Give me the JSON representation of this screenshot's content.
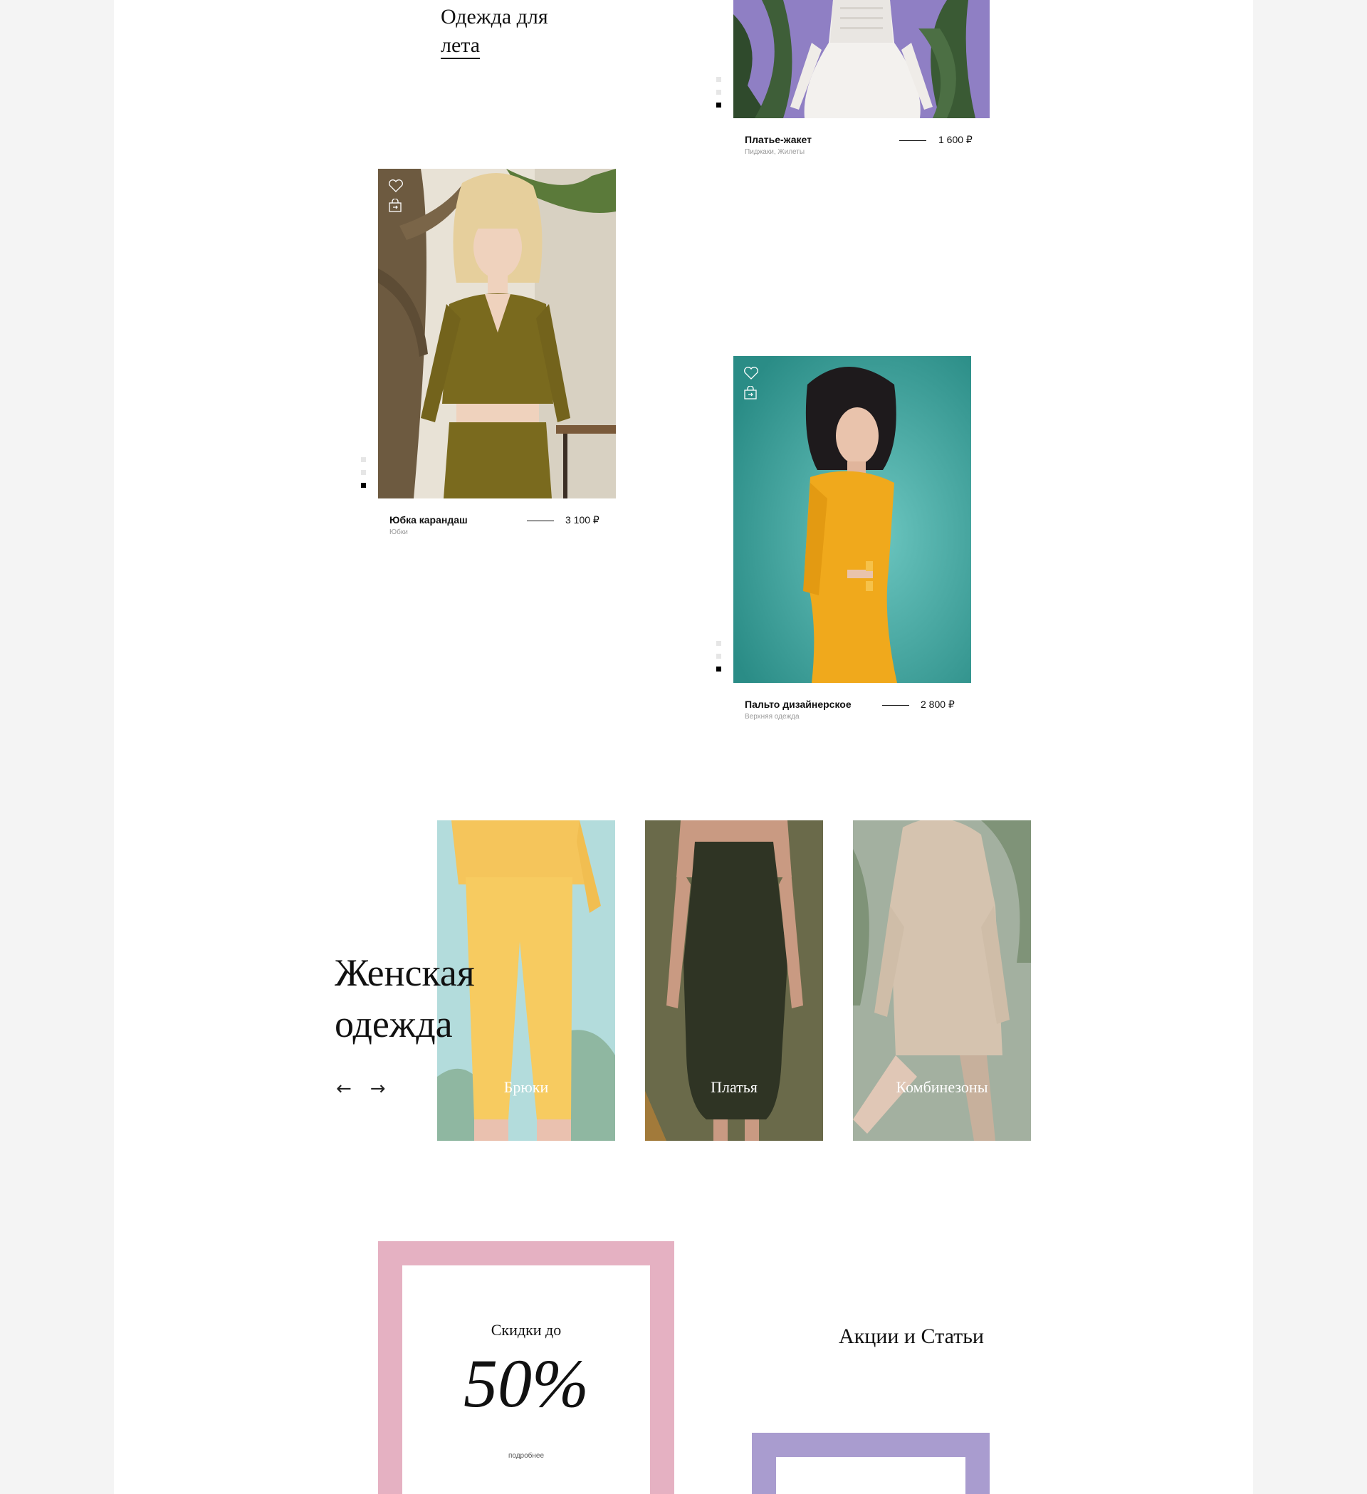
{
  "summer": {
    "line1": "Одежда для",
    "line2": "лета"
  },
  "products": [
    {
      "name": "Платье-жакет",
      "category": "Пиджаки, Жилеты",
      "price": "1 600 ₽"
    },
    {
      "name": "Юбка карандаш",
      "category": "Юбки",
      "price": "3 100 ₽"
    },
    {
      "name": "Пальто дизайнерское",
      "category": "Верхняя одежда",
      "price": "2 800 ₽"
    }
  ],
  "icons": {
    "wishlist": "heart-icon",
    "cart": "bag-icon"
  },
  "women": {
    "line1": "Женская",
    "line2": "одежда",
    "prev": "←",
    "next": "→",
    "categories": [
      {
        "label": "Брюки"
      },
      {
        "label": "Платья"
      },
      {
        "label": "Комбинезоны"
      }
    ]
  },
  "sale": {
    "prefix": "Скидки до",
    "value": "50%",
    "more": "подробнее"
  },
  "articles": {
    "title": "Акции и Статьи"
  },
  "colors": {
    "background": "#f4f4f4",
    "page": "#ffffff",
    "sale_frame": "#e5b1c2",
    "promo_frame": "#a99ccf",
    "purple_photo": "#8f7fc4",
    "teal_photo": "#4fb3ad",
    "olive": "#7a6a1e",
    "mustard": "#f0a91c"
  }
}
